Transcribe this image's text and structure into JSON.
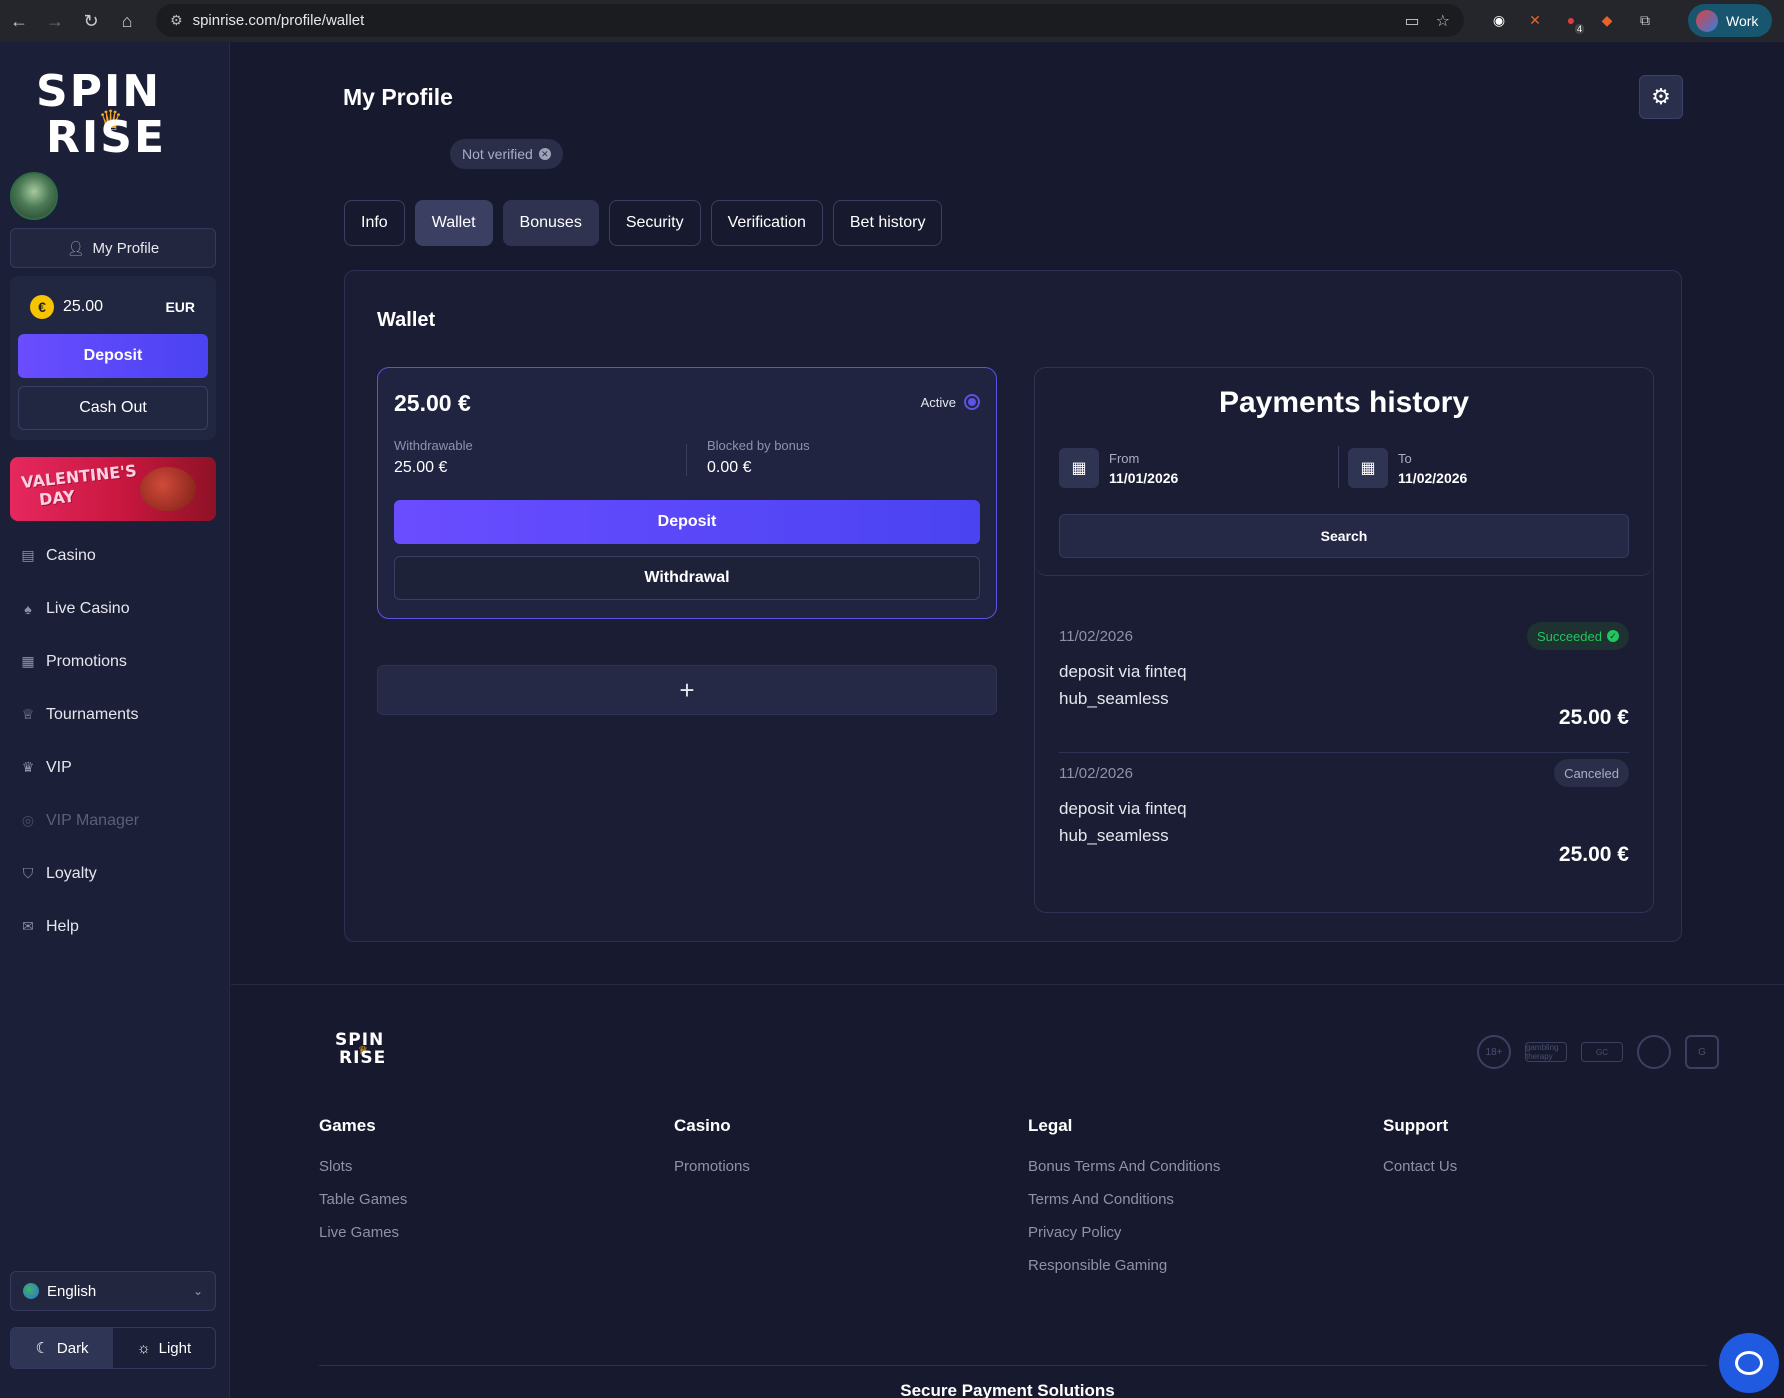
{
  "browser": {
    "url": "spinrise.com/profile/wallet",
    "profile_label": "Work",
    "ext_badge": "4"
  },
  "sidebar": {
    "logo_line1": "SPIN",
    "logo_line2": "RISE",
    "profile_button": "My Profile",
    "balance": {
      "amount": "25.00",
      "currency": "EUR",
      "coin_symbol": "€"
    },
    "deposit_label": "Deposit",
    "cashout_label": "Cash Out",
    "promo_text_1": "VALENTINE'S",
    "promo_text_2": "DAY",
    "menu": [
      {
        "label": "Casino",
        "icon": "casino-icon"
      },
      {
        "label": "Live Casino",
        "icon": "live-casino-icon"
      },
      {
        "label": "Promotions",
        "icon": "gift-icon"
      },
      {
        "label": "Tournaments",
        "icon": "trophy-icon"
      },
      {
        "label": "VIP",
        "icon": "crown-icon"
      },
      {
        "label": "VIP Manager",
        "icon": "headset-icon"
      },
      {
        "label": "Loyalty",
        "icon": "shield-icon"
      },
      {
        "label": "Help",
        "icon": "mail-icon"
      }
    ],
    "language": "English",
    "theme": {
      "dark": "Dark",
      "light": "Light"
    }
  },
  "main": {
    "title": "My Profile",
    "verification_badge": "Not verified",
    "tabs": [
      "Info",
      "Wallet",
      "Bonuses",
      "Security",
      "Verification",
      "Bet history"
    ],
    "active_tab": "Wallet",
    "panel_title": "Wallet",
    "wallet": {
      "amount": "25.00 €",
      "active_label": "Active",
      "withdrawable_label": "Withdrawable",
      "withdrawable_value": "25.00 €",
      "blocked_label": "Blocked by bonus",
      "blocked_value": "0.00 €",
      "deposit_label": "Deposit",
      "withdrawal_label": "Withdrawal",
      "add_label": "+"
    },
    "history": {
      "title": "Payments history",
      "from_label": "From",
      "from_value": "11/01/2026",
      "to_label": "To",
      "to_value": "11/02/2026",
      "search_label": "Search",
      "transactions": [
        {
          "date": "11/02/2026",
          "desc": "deposit via finteqhub_seamless",
          "amount": "25.00 €",
          "status": "Succeeded"
        },
        {
          "date": "11/02/2026",
          "desc": "deposit via finteqhub_seamless",
          "amount": "25.00 €",
          "status": "Canceled"
        }
      ]
    }
  },
  "footer": {
    "logo_line1": "SPIN",
    "logo_line2": "RISE",
    "certs": [
      "18+",
      "gambling therapy",
      "GC",
      "",
      "G"
    ],
    "columns": [
      {
        "heading": "Games",
        "links": [
          "Slots",
          "Table Games",
          "Live Games"
        ]
      },
      {
        "heading": "Casino",
        "links": [
          "Promotions"
        ]
      },
      {
        "heading": "Legal",
        "links": [
          "Bonus Terms And Conditions",
          "Terms And Conditions",
          "Privacy Policy",
          "Responsible Gaming"
        ]
      },
      {
        "heading": "Support",
        "links": [
          "Contact Us"
        ]
      }
    ],
    "secure_heading": "Secure Payment Solutions"
  },
  "colors": {
    "accent": "#5b52e6",
    "success": "#22c55e",
    "background": "#171a2e",
    "sidebar": "#1b1f37"
  }
}
